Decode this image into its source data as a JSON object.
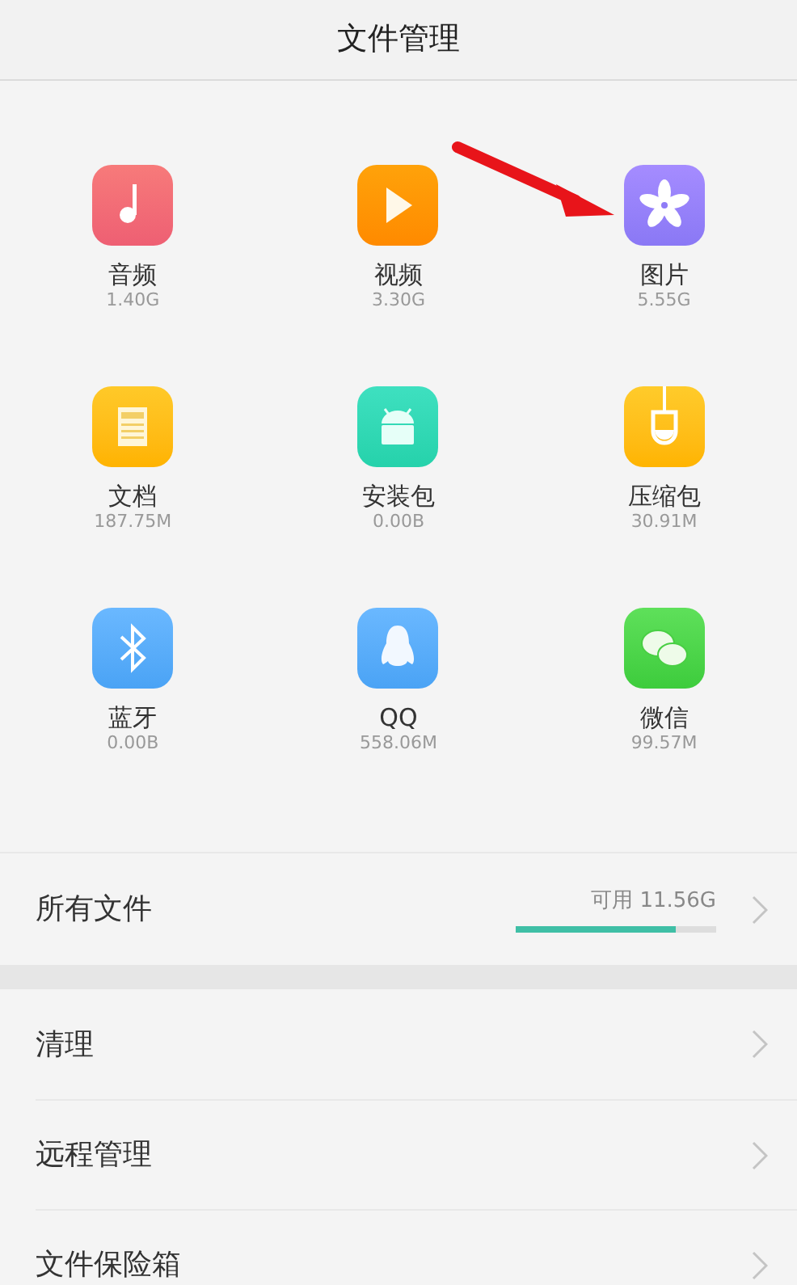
{
  "header": {
    "title": "文件管理"
  },
  "categories": [
    {
      "label": "音频",
      "size": "1.40G"
    },
    {
      "label": "视频",
      "size": "3.30G"
    },
    {
      "label": "图片",
      "size": "5.55G"
    },
    {
      "label": "文档",
      "size": "187.75M"
    },
    {
      "label": "安装包",
      "size": "0.00B"
    },
    {
      "label": "压缩包",
      "size": "30.91M"
    },
    {
      "label": "蓝牙",
      "size": "0.00B"
    },
    {
      "label": "QQ",
      "size": "558.06M"
    },
    {
      "label": "微信",
      "size": "99.57M"
    }
  ],
  "storage": {
    "label": "所有文件",
    "available": "可用 11.56G",
    "level": 0.8
  },
  "menu": [
    {
      "label": "清理"
    },
    {
      "label": "远程管理"
    },
    {
      "label": "文件保险箱"
    }
  ]
}
